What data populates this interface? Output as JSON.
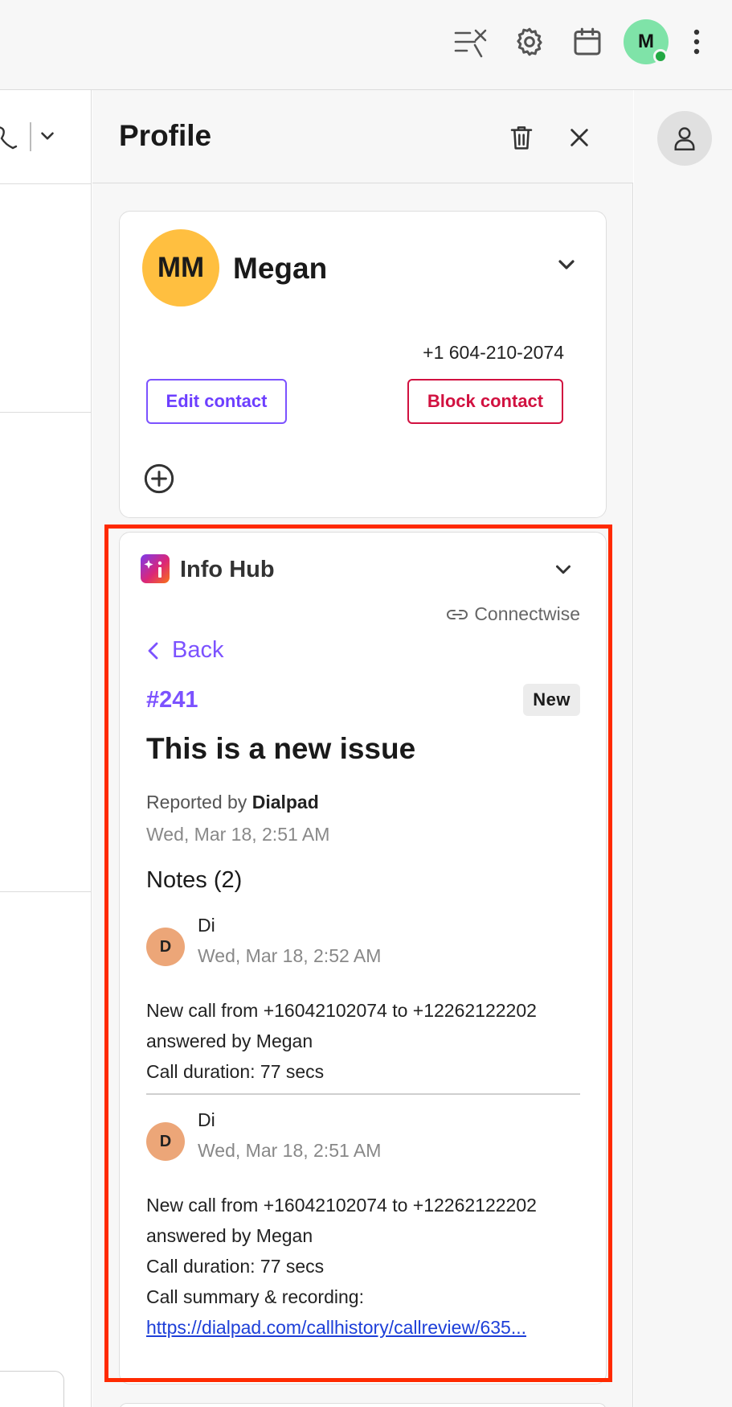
{
  "topbar": {
    "icons": [
      "connection-off-icon",
      "gear-icon",
      "calendar-icon",
      "more-vertical-icon"
    ],
    "user_avatar_initial": "M",
    "presence": "online"
  },
  "panel": {
    "title": "Profile",
    "header_actions": [
      "trash-icon",
      "close-icon"
    ]
  },
  "contact": {
    "initials": "MM",
    "name": "Megan",
    "phone": "+1 604-210-2074",
    "edit_label": "Edit contact",
    "block_label": "Block contact"
  },
  "info_hub": {
    "title": "Info Hub",
    "source": "Connectwise",
    "back_label": "Back",
    "ticket": {
      "id": "#241",
      "status": "New",
      "title": "This is a new issue",
      "reported_prefix": "Reported by",
      "reported_by": "Dialpad",
      "date": "Wed, Mar 18, 2:51 AM"
    },
    "notes_title": "Notes (2)",
    "notes": [
      {
        "avatar_initial": "D",
        "author": "Di",
        "date": "Wed, Mar 18, 2:52 AM",
        "lines": [
          "New call from +16042102074 to +12262122202",
          "answered by Megan",
          "Call duration: 77 secs"
        ]
      },
      {
        "avatar_initial": "D",
        "author": "Di",
        "date": "Wed, Mar 18, 2:51 AM",
        "lines": [
          "New call from +16042102074 to +12262122202",
          "answered by Megan",
          "Call duration: 77 secs",
          "Call summary & recording:"
        ],
        "link": "https://dialpad.com/callhistory/callreview/635..."
      }
    ]
  },
  "colors": {
    "accent": "#7c52ff",
    "danger": "#d11140",
    "highlight": "#ff2a00",
    "avatar_contact": "#ffbf40",
    "avatar_note": "#eca678",
    "presence_online": "#22a843"
  }
}
